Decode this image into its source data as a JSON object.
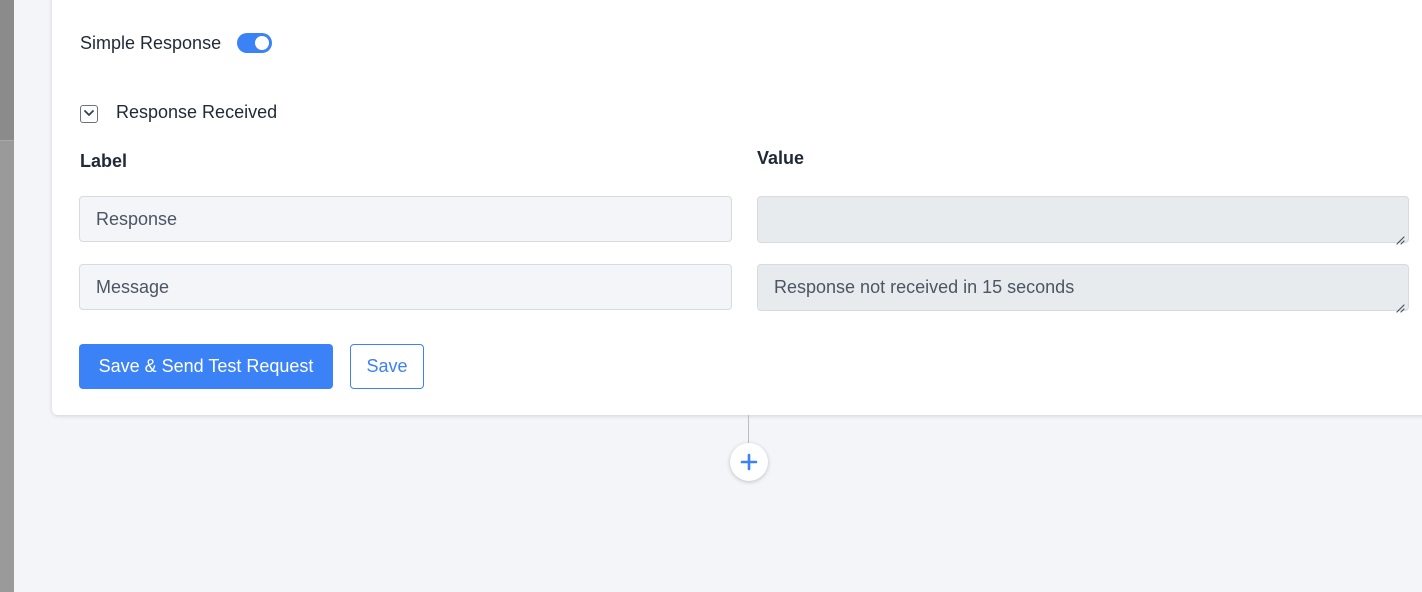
{
  "simple_response": {
    "label": "Simple Response",
    "enabled": true
  },
  "response_section": {
    "title": "Response Received",
    "expanded": true,
    "icon": "chevron-down-icon"
  },
  "columns": {
    "label_header": "Label",
    "value_header": "Value"
  },
  "rows": [
    {
      "label": "Response",
      "value": ""
    },
    {
      "label": "Message",
      "value": "Response not received in 15 seconds"
    }
  ],
  "actions": {
    "save_and_test_label": "Save & Send Test Request",
    "save_label": "Save"
  },
  "add_step": {
    "icon": "plus-icon"
  },
  "colors": {
    "accent": "#3b82f6",
    "background": "#f3f5f8"
  }
}
